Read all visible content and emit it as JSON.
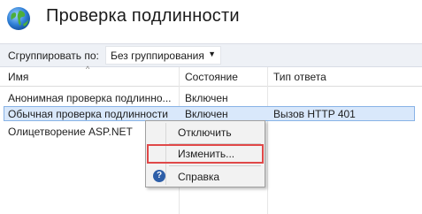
{
  "header": {
    "title": "Проверка подлинности",
    "icon": "globe-icon"
  },
  "toolbar": {
    "group_by_label": "Сгруппировать по:",
    "group_by_value": "Без группирования"
  },
  "columns": {
    "name": "Имя",
    "state": "Состояние",
    "response": "Тип ответа"
  },
  "rows": [
    {
      "name": "Анонимная проверка подлинно...",
      "state": "Включен",
      "response": ""
    },
    {
      "name": "Обычная проверка подлинности",
      "state": "Включен",
      "response": "Вызов HTTP 401"
    },
    {
      "name": "Олицетворение ASP.NET",
      "state": "",
      "response": ""
    }
  ],
  "context_menu": {
    "disable": "Отключить",
    "edit": "Изменить...",
    "help": "Справка"
  },
  "colors": {
    "selection": "#d9e8fb",
    "highlight_border": "#e04848"
  }
}
